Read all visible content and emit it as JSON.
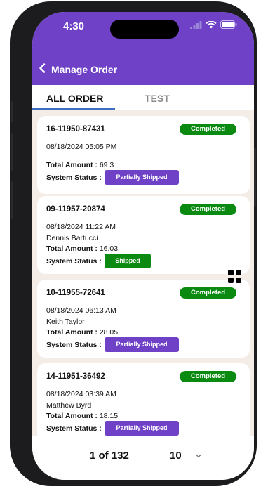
{
  "status_bar": {
    "time": "4:30"
  },
  "header": {
    "title": "Manage Order"
  },
  "tabs": [
    {
      "label": "ALL ORDER",
      "active": true
    },
    {
      "label": "TEST",
      "active": false
    }
  ],
  "labels": {
    "total_amount": "Total Amount :",
    "system_status": "System Status :"
  },
  "orders": [
    {
      "id": "16-11950-87431",
      "status": "Completed",
      "date": "08/18/2024 05:05 PM",
      "customer": "",
      "total": "69.3",
      "system_status": "Partially Shipped"
    },
    {
      "id": "09-11957-20874",
      "status": "Completed",
      "date": "08/18/2024 11:22 AM",
      "customer": "Dennis Bartucci",
      "total": "16.03",
      "system_status": "Shipped"
    },
    {
      "id": "10-11955-72641",
      "status": "Completed",
      "date": "08/18/2024 06:13 AM",
      "customer": "Keith Taylor",
      "total": "28.05",
      "system_status": "Partially Shipped"
    },
    {
      "id": "14-11951-36492",
      "status": "Completed",
      "date": "08/18/2024 03:39 AM",
      "customer": "Matthew Byrd",
      "total": "18.15",
      "system_status": "Partially Shipped"
    }
  ],
  "pagination": {
    "page_label": "1 of 132",
    "page_size": "10"
  },
  "colors": {
    "brand": "#6e41c6",
    "success": "#0a8a10",
    "tab_indicator": "#3a6fc4"
  }
}
